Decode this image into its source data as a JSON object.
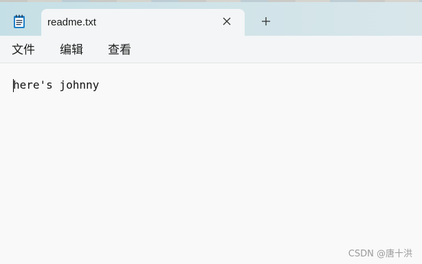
{
  "window": {
    "app_icon": "notepad-icon",
    "tab_title": "readme.txt",
    "tab_close_icon": "close-icon",
    "new_tab_icon": "plus-icon",
    "accent_color": "#c5dfe6"
  },
  "menu": {
    "items": [
      {
        "label": "文件"
      },
      {
        "label": "编辑"
      },
      {
        "label": "查看"
      }
    ]
  },
  "editor": {
    "content": "here's johnny"
  },
  "watermark": {
    "text": "CSDN @唐十洪"
  }
}
